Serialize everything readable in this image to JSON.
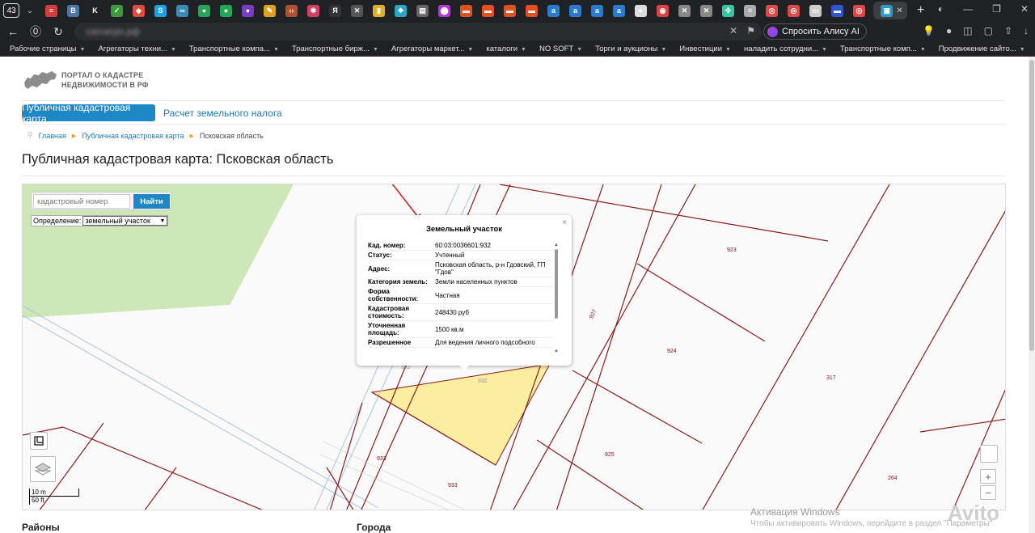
{
  "browser": {
    "tab_count": "43",
    "alice_button": "Спросить Алису AI",
    "address_text": "сагсигрп.рф",
    "bookmarks": [
      {
        "label": "Рабочие страницы",
        "folder": true
      },
      {
        "label": "Агрегаторы техни...",
        "folder": true
      },
      {
        "label": "Транспортные компа...",
        "folder": true
      },
      {
        "label": "Транспортные бирж...",
        "folder": true
      },
      {
        "label": "Агрегаторы маркет...",
        "folder": true
      },
      {
        "label": "каталоги",
        "folder": true
      },
      {
        "label": "NO SOFT",
        "folder": true
      },
      {
        "label": "Торги и аукционы",
        "folder": true
      },
      {
        "label": "Инвестиции",
        "folder": true
      },
      {
        "label": "наладить сотрудни...",
        "folder": true
      },
      {
        "label": "Транспортные комп...",
        "folder": true
      },
      {
        "label": "Продвижение сайто...",
        "folder": true
      }
    ],
    "tab_favicons": [
      {
        "icon": "news-icon",
        "color": "#d23d3d",
        "glyph": "≡"
      },
      {
        "icon": "vk-icon",
        "color": "#4a76a8",
        "glyph": "В"
      },
      {
        "icon": "kinopoisk-icon",
        "color": "#222222",
        "glyph": "K"
      },
      {
        "icon": "check-icon",
        "color": "#3c9a3c",
        "glyph": "✓"
      },
      {
        "icon": "rocket-icon",
        "color": "#e04b3b",
        "glyph": "◆"
      },
      {
        "icon": "skype-icon",
        "color": "#1aa3e8",
        "glyph": "S"
      },
      {
        "icon": "cloud-icon",
        "color": "#3a8ab5",
        "glyph": "∞"
      },
      {
        "icon": "leaf-icon",
        "color": "#25a55b",
        "glyph": "●"
      },
      {
        "icon": "whatsapp-icon",
        "color": "#1fa855",
        "glyph": "●"
      },
      {
        "icon": "circle-icon",
        "color": "#7a3cc4",
        "glyph": "●"
      },
      {
        "icon": "pencil-icon",
        "color": "#e0a020",
        "glyph": "✎"
      },
      {
        "icon": "code-icon",
        "color": "#b05030",
        "glyph": "‹›"
      },
      {
        "icon": "gear-icon",
        "color": "#d04060",
        "glyph": "✱"
      },
      {
        "icon": "yandex-icon",
        "color": "#333333",
        "glyph": "Я"
      },
      {
        "icon": "cross-icon",
        "color": "#555555",
        "glyph": "✕"
      },
      {
        "icon": "book-icon",
        "color": "#e0b020",
        "glyph": "▮"
      },
      {
        "icon": "puzzle-icon",
        "color": "#2aa6c4",
        "glyph": "❖"
      },
      {
        "icon": "doc-icon",
        "color": "#666666",
        "glyph": "▤"
      },
      {
        "icon": "pin-icon",
        "color": "#b03ad0",
        "glyph": "⬤"
      },
      {
        "icon": "mail-icon",
        "color": "#e05020",
        "glyph": "▬"
      },
      {
        "icon": "mail-icon",
        "color": "#e05020",
        "glyph": "▬"
      },
      {
        "icon": "mail-icon",
        "color": "#e05020",
        "glyph": "▬"
      },
      {
        "icon": "mail-icon",
        "color": "#e05020",
        "glyph": "▬"
      },
      {
        "icon": "letter-a-icon",
        "color": "#2a7ad0",
        "glyph": "a"
      },
      {
        "icon": "letter-a-icon",
        "color": "#2a7ad0",
        "glyph": "a"
      },
      {
        "icon": "letter-a-icon",
        "color": "#2a7ad0",
        "glyph": "a"
      },
      {
        "icon": "letter-a-icon",
        "color": "#2a7ad0",
        "glyph": "a"
      },
      {
        "icon": "github-icon",
        "color": "#dddddd",
        "glyph": "●"
      },
      {
        "icon": "map-pin-icon",
        "color": "#e04040",
        "glyph": "◉"
      },
      {
        "icon": "cross-icon",
        "color": "#888888",
        "glyph": "✕"
      },
      {
        "icon": "cross-icon",
        "color": "#888888",
        "glyph": "✕"
      },
      {
        "icon": "slack-icon",
        "color": "#36c5a0",
        "glyph": "✣"
      },
      {
        "icon": "lines-icon",
        "color": "#aaaaaa",
        "glyph": "≡"
      },
      {
        "icon": "avito-icon",
        "color": "#e04848",
        "glyph": "◎"
      },
      {
        "icon": "avito-icon",
        "color": "#e04848",
        "glyph": "◎"
      },
      {
        "icon": "slides-icon",
        "color": "#cccccc",
        "glyph": "▭"
      },
      {
        "icon": "flag-icon",
        "color": "#3355cc",
        "glyph": "▬"
      },
      {
        "icon": "avito-icon",
        "color": "#e04848",
        "glyph": "◎"
      }
    ]
  },
  "site": {
    "logo_line1": "ПОРТАЛ О КАДАСТРЕ",
    "logo_line2": "НЕДВИЖИМОСТИ В РФ",
    "nav_active": "Публичная кадастровая карта",
    "nav_other": "Расчет земельного налога",
    "breadcrumbs": [
      "Главная",
      "Публичная кадастровая карта",
      "Псковская область"
    ],
    "page_title": "Публичная кадастровая карта: Псковская область"
  },
  "map": {
    "search_placeholder": "кадастровый номер",
    "search_button": "Найти",
    "definition_label": "Определение:",
    "definition_value": "земельный участок",
    "scale_metric": "10 m",
    "scale_imperial": "50 ft",
    "zoom_in": "+",
    "zoom_out": "−",
    "plot_labels": [
      "923",
      "927",
      "924",
      "317",
      "932",
      "932",
      "933",
      "933",
      "925",
      "264"
    ]
  },
  "popup": {
    "title": "Земельный участок",
    "close": "×",
    "rows": [
      {
        "key": "Кад. номер:",
        "value": "60:03:0036601:932"
      },
      {
        "key": "Статус:",
        "value": "Учтенный"
      },
      {
        "key": "Адрес:",
        "value": "Псковская область, р-н Гдовский, ГП \"Гдов\""
      },
      {
        "key": "Категория земель:",
        "value": "Земли населенных пунктов"
      },
      {
        "key": "Форма собственности:",
        "value": "Частная"
      },
      {
        "key": "Кадастровая стоимость:",
        "value": "248430 руб"
      },
      {
        "key": "Уточненная площадь:",
        "value": "1500 кв.м"
      },
      {
        "key": "Разрешенное",
        "value": "Для ведения личного подсобного"
      }
    ]
  },
  "sections": {
    "districts": "Районы",
    "cities": "Города"
  },
  "watermark": {
    "title": "Активация Windows",
    "subtitle": "Чтобы активировать Windows, перейдите в раздел \"Параметры\".",
    "brand": "Avito"
  },
  "colors": {
    "accent": "#1e88c7",
    "plot_line": "#8b1a1a",
    "selected_plot": "#fbeea0",
    "green_zone": "#cde8b6"
  }
}
